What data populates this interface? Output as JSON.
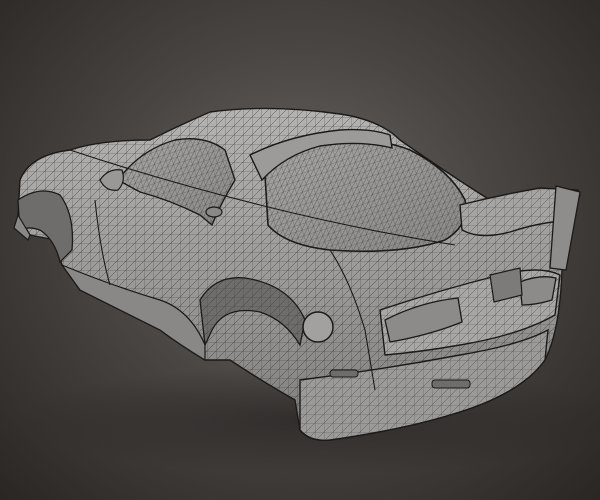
{
  "scene": {
    "subject": "car-body-wireframe",
    "colors": {
      "background_center": "#6a6664",
      "background_edge": "#2a2624",
      "body_fill": "#8f8d8b",
      "body_highlight": "#b5b3b1",
      "wire": "#2e2c2b",
      "outline": "#1b1a19",
      "shadow": "#1c1a19"
    }
  }
}
